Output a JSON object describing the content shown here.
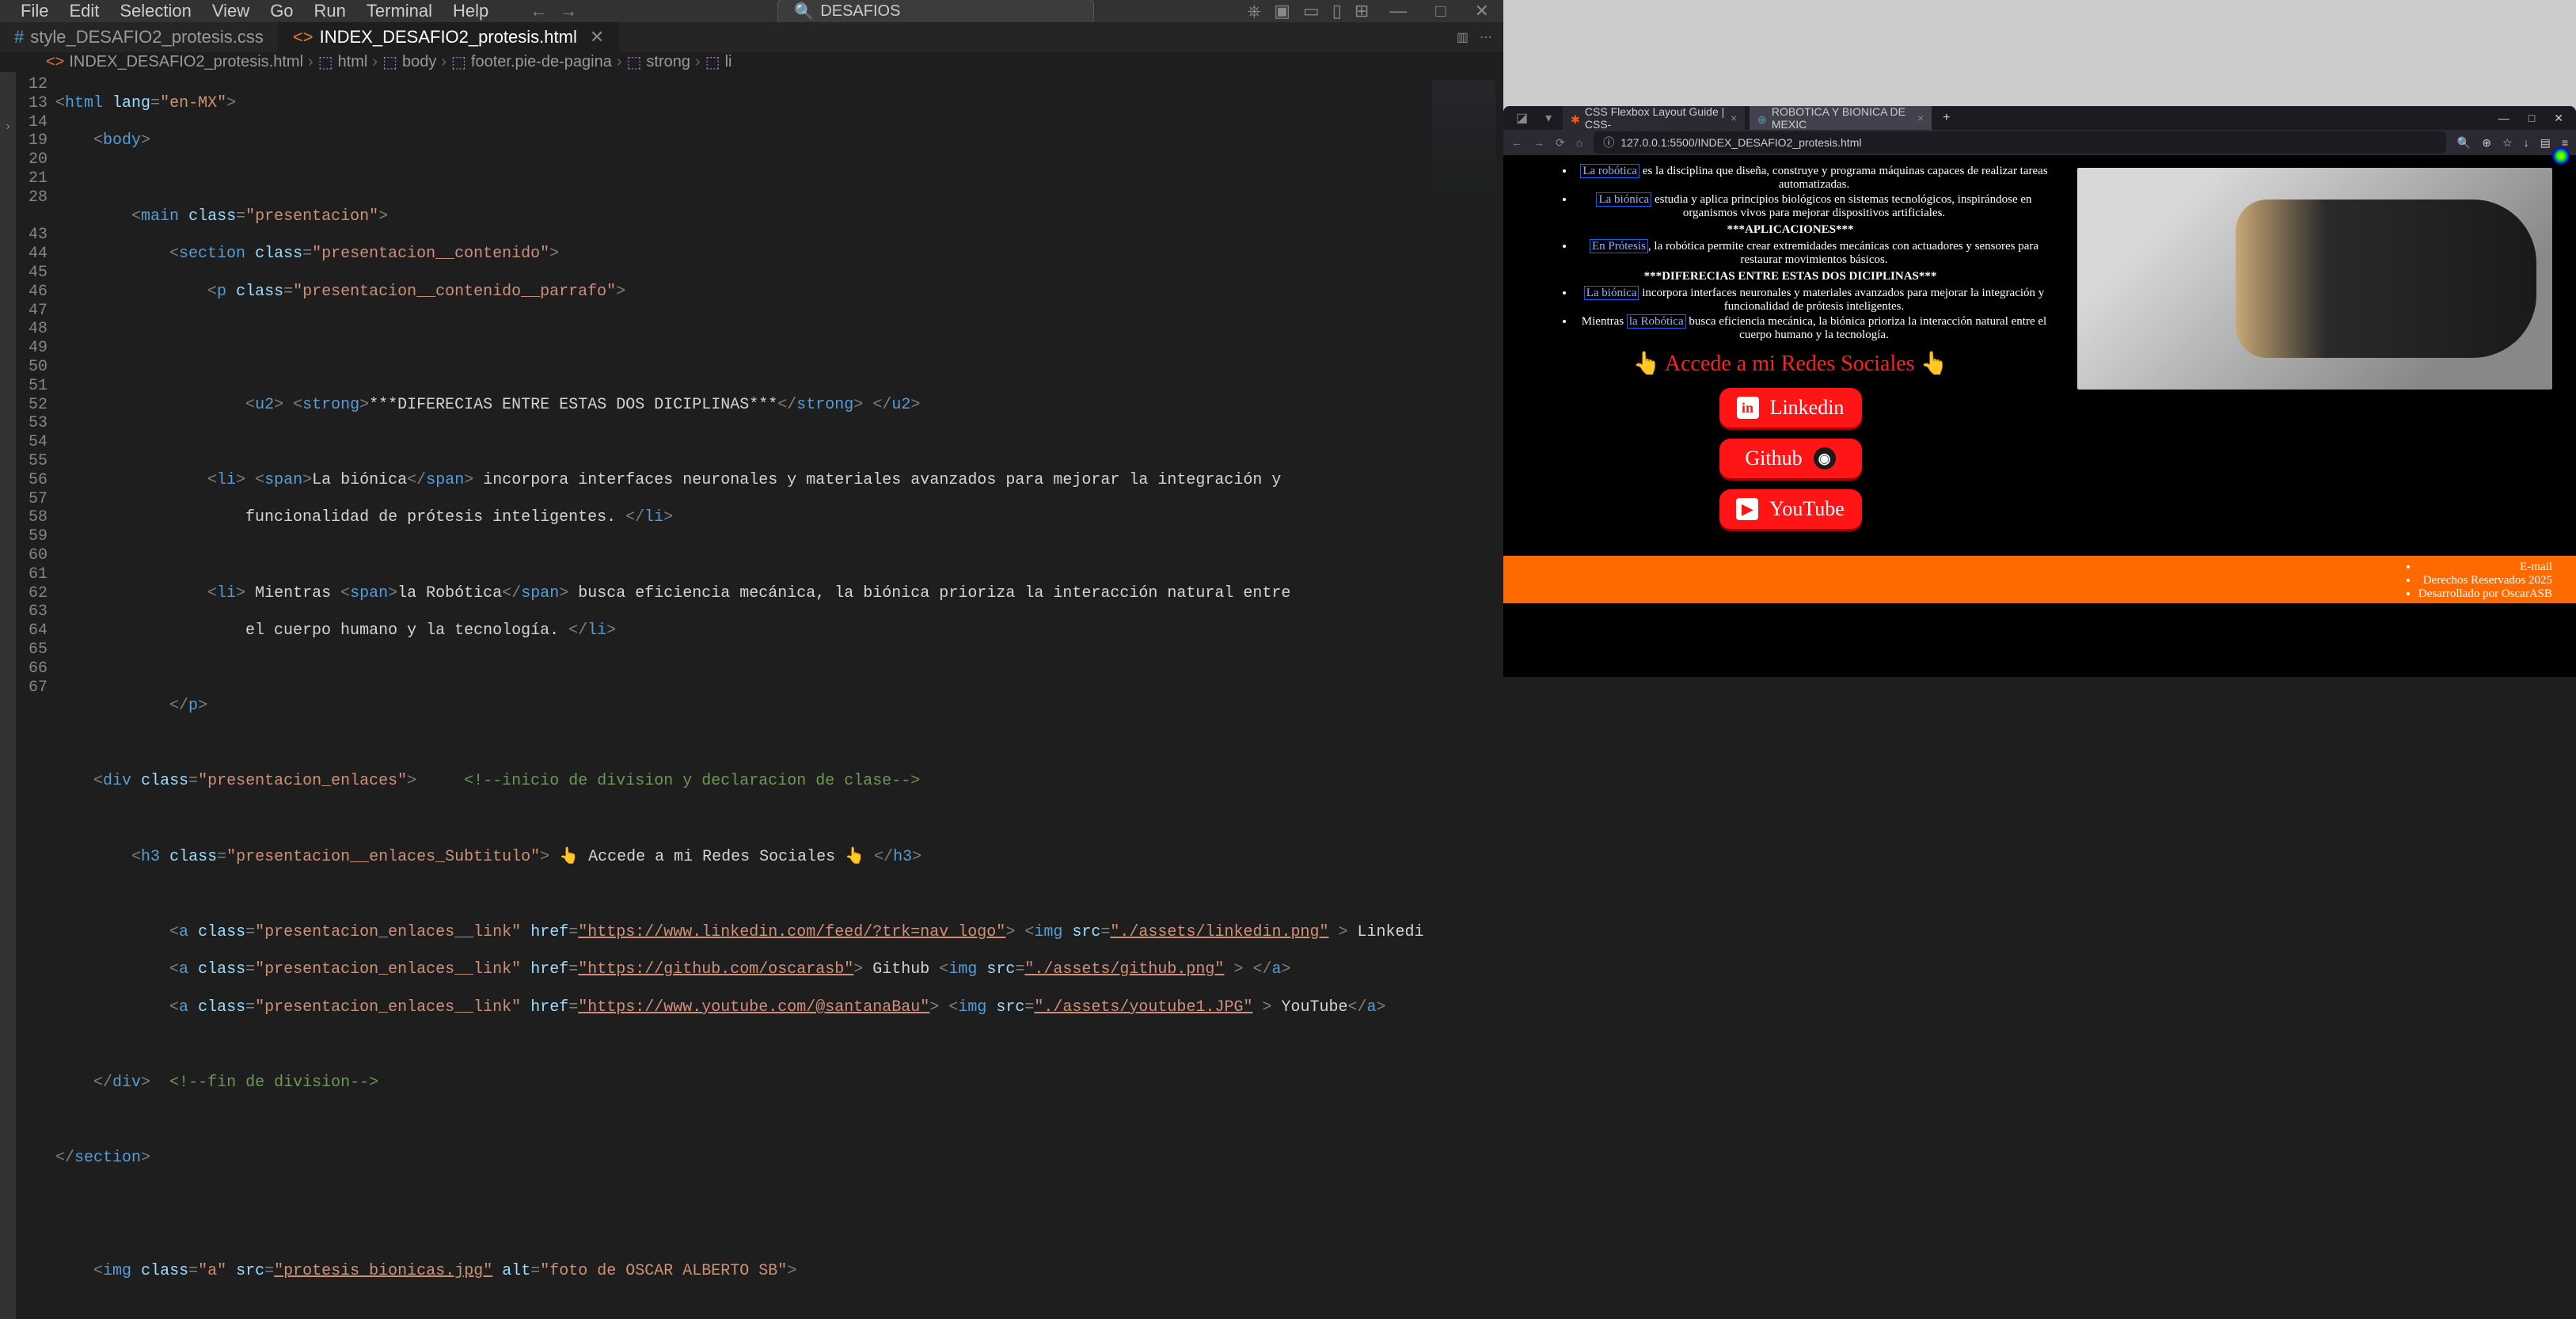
{
  "menu": [
    "File",
    "Edit",
    "Selection",
    "View",
    "Go",
    "Run",
    "Terminal",
    "Help"
  ],
  "search_placeholder": "DESAFIOS",
  "tabs": [
    {
      "label": "style_DESAFIO2_protesis.css",
      "icon": "#",
      "active": false
    },
    {
      "label": "INDEX_DESAFIO2_protesis.html",
      "icon": "<>",
      "active": true
    }
  ],
  "breadcrumb": [
    "INDEX_DESAFIO2_protesis.html",
    "html",
    "body",
    "footer.pie-de-pagina",
    "strong",
    "li"
  ],
  "line_numbers": [
    "12",
    "13",
    "14",
    "19",
    "20",
    "21",
    "28",
    "",
    "43",
    "44",
    "45",
    "46",
    "47",
    "48",
    "49",
    "50",
    "51",
    "52",
    "53",
    "54",
    "55",
    "56",
    "57",
    "58",
    "59",
    "60",
    "61",
    "62",
    "63",
    "64",
    "65",
    "66",
    "67"
  ],
  "code": {
    "l12": "<html lang=\"en-MX\">",
    "l13": "    <body>",
    "l14": "",
    "l19": "        <main class=\"presentacion\">",
    "l20": "            <section class=\"presentacion__contenido\">",
    "l21": "                <p class=\"presentacion__contenido__parrafo\">",
    "l28": "",
    "l43": "",
    "l44": "                    <u2> <strong>***DIFERECIAS ENTRE ESTAS DOS DICIPLINAS***</strong> </u2>",
    "l45": "",
    "l46": "                <li> <span>La biónica</span> incorpora interfaces neuronales y materiales avanzados para mejorar la integración y",
    "l47": "                    funcionalidad de prótesis inteligentes. </li>",
    "l48": "",
    "l49": "                <li> Mientras <span>la Robótica</span> busca eficiencia mecánica, la biónica prioriza la interacción natural entre",
    "l50": "                    el cuerpo humano y la tecnología. </li>",
    "l51": "",
    "l52": "            </p>",
    "l53": "",
    "l54_a": "    <div class=\"presentacion_enlaces\">",
    "l54_b": "     <!--inicio de division y declaracion de clase-->",
    "l55": "",
    "l56": "        <h3 class=\"presentacion__enlaces_Subtitulo\"> 👆 Accede a mi Redes Sociales 👆 </h3>",
    "l57": "",
    "l58": "            <a class=\"presentacion_enlaces__link\" href=\"https://www.linkedin.com/feed/?trk=nav_logo\"> <img src=\"./assets/linkedin.png\" > Linkedin </a>",
    "l59": "            <a class=\"presentacion_enlaces__link\" href=\"https://github.com/oscarasb\"> Github <img src=\"./assets/github.png\" > </a>",
    "l60": "            <a class=\"presentacion_enlaces__link\" href=\"https://www.youtube.com/@santanaBau\"> <img src=\"./assets/youtube1.JPG\" > YouTube</a>",
    "l61": "",
    "l62_a": "    </div>",
    "l62_b": "  <!--fin de division-->",
    "l63": "",
    "l64": "</section>",
    "l65": "",
    "l66": "",
    "l67": "    <img class=\"a\" src=\"protesis_bionicas.jpg\" alt=\"foto de OSCAR ALBERTO SB\">"
  },
  "browser": {
    "tabs": [
      {
        "label": "CSS Flexbox Layout Guide | CSS-",
        "icon_color": "#ff5e00"
      },
      {
        "label": "ROBOTICA Y BIONICA DE MEXIC",
        "icon_color": "#4aa"
      }
    ],
    "url": "127.0.0.1:5500/INDEX_DESAFIO2_protesis.html",
    "page": {
      "bullets": [
        {
          "link": "La robótica",
          "text": " es la disciplina que diseña, construye y programa máquinas capaces de realizar tareas automatizadas."
        },
        {
          "link": "La biónica",
          "text": " estudia y aplica principios biológicos en sistemas tecnológicos, inspirándose en organismos vivos para mejorar dispositivos artificiales."
        }
      ],
      "apps_title": "***APLICACIONES***",
      "apps": [
        {
          "link": "En Prótesis",
          "text": ", la robótica permite crear extremidades mecánicas con actuadores y sensores para restaurar movimientos básicos."
        }
      ],
      "diff_title": "***DIFERECIAS ENTRE ESTAS DOS DICIPLINAS***",
      "diffs": [
        {
          "link": "La biónica",
          "text": " incorpora interfaces neuronales y materiales avanzados para mejorar la integración y funcionalidad de prótesis inteligentes."
        },
        {
          "pre": "Mientras ",
          "link": "la Robótica",
          "text": " busca eficiencia mecánica, la biónica prioriza la interacción natural entre el cuerpo humano y la tecnología."
        }
      ],
      "socials_heading": "👆 Accede a mi Redes Sociales 👆",
      "socials": [
        {
          "label": "Linkedin",
          "icon": "in"
        },
        {
          "label": "Github",
          "icon": "gh"
        },
        {
          "label": "YouTube",
          "icon": "▶"
        }
      ],
      "footer": [
        "E-mail",
        "Derechos Reservados 2025",
        "Desarrollado por OscarASB"
      ]
    }
  }
}
